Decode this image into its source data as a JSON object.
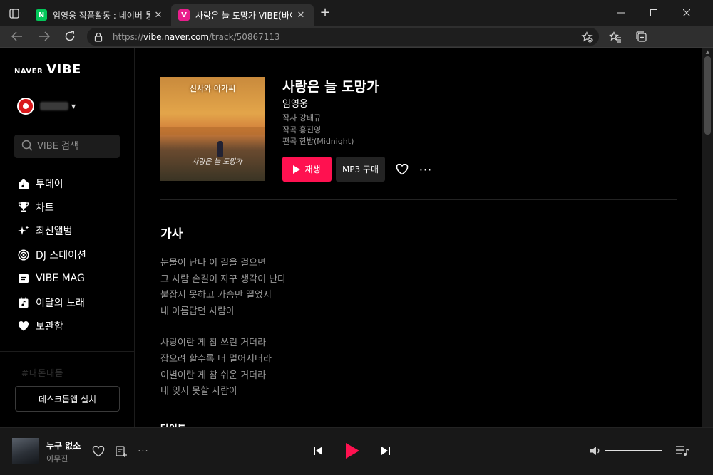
{
  "browser": {
    "tabs": [
      {
        "title": "임영웅 작품활동 : 네이버 통합검색",
        "favicon_letter": "N",
        "favicon_color": "#03c75a",
        "active": false
      },
      {
        "title": "사랑은 늘 도망가 VIBE(바이브)",
        "favicon_letter": "V",
        "favicon_color": "#e91e8c",
        "active": true
      }
    ],
    "new_tab_label": "+",
    "url": {
      "scheme": "https://",
      "host": "vibe.naver.com",
      "path": "/track/50867113"
    }
  },
  "sidebar": {
    "logo_naver": "NAVER",
    "logo_vibe": "VIBE",
    "search_placeholder": "VIBE 검색",
    "nav_items": [
      {
        "label": "투데이",
        "icon": "home-note-icon"
      },
      {
        "label": "차트",
        "icon": "trophy-icon"
      },
      {
        "label": "최신앨범",
        "icon": "sparkle-icon"
      },
      {
        "label": "DJ 스테이션",
        "icon": "radio-icon"
      },
      {
        "label": "VIBE MAG",
        "icon": "magazine-icon"
      },
      {
        "label": "이달의 노래",
        "icon": "calendar-note-icon"
      },
      {
        "label": "보관함",
        "icon": "heart-icon"
      }
    ],
    "promo_text": "#내돈내듣",
    "install_label": "데스크톱앱 설치"
  },
  "track": {
    "title": "사랑은 늘 도망가",
    "artist": "임영웅",
    "credits": [
      "작사 강태규",
      "작곡 홍진영",
      "편곡 한밤(Midnight)"
    ],
    "play_label": "재생",
    "mp3_label": "MP3 구매",
    "cover_title": "신사와 아가씨",
    "cover_caption": "사랑은 늘 도망가"
  },
  "lyrics": {
    "heading": "가사",
    "stanzas": [
      [
        "눈물이 난다 이 길을 걸으면",
        "그 사람 손길이 자꾸 생각이 난다",
        "붙잡지 못하고 가슴만 떨었지",
        "내 아름답던 사람아"
      ],
      [
        "사랑이란 게 참 쓰린 거더라",
        "잡으려 할수록 더 멀어지더라",
        "이별이란 게 참 쉬운 거더라",
        "내 잊지 못할 사람아"
      ]
    ],
    "next_heading": "타이틀"
  },
  "player": {
    "title": "누구 없소",
    "artist": "이무진",
    "volume_percent": 100,
    "accent_color": "#ff1150"
  }
}
